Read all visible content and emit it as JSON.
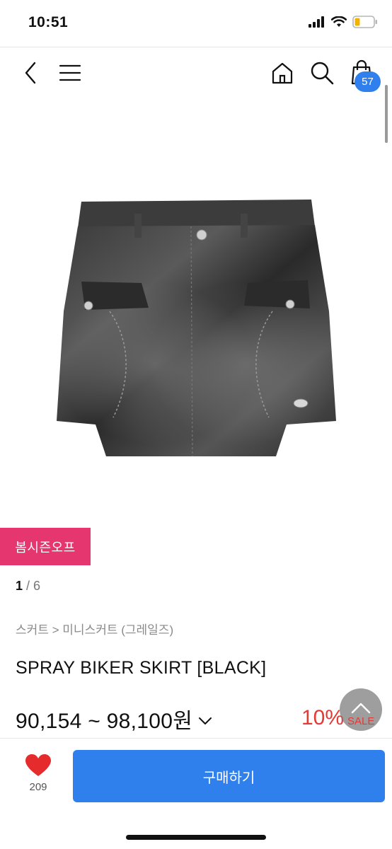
{
  "status_bar": {
    "time": "10:51"
  },
  "nav": {
    "cart_count": "57"
  },
  "promo": {
    "tag": "봄시즌오프"
  },
  "gallery": {
    "current": "1",
    "separator": " / ",
    "total": "6"
  },
  "product": {
    "breadcrumb": "스커트 > 미니스커트 (그레일즈)",
    "title": "SPRAY BIKER SKIRT [BLACK]",
    "price_range": "90,154 ~ 98,100원",
    "discount": "10%",
    "sale_label": "SALE"
  },
  "bottom_bar": {
    "like_count": "209",
    "buy_label": "구매하기"
  },
  "icons": [
    "back-icon",
    "menu-icon",
    "home-icon",
    "search-icon",
    "shopping-bag-icon",
    "heart-icon",
    "chevron-down-icon",
    "chevron-up-icon"
  ],
  "colors": {
    "accent": "#2f80ed",
    "promo": "#e5366f",
    "discount": "#e53935",
    "heart": "#e52b2b"
  }
}
